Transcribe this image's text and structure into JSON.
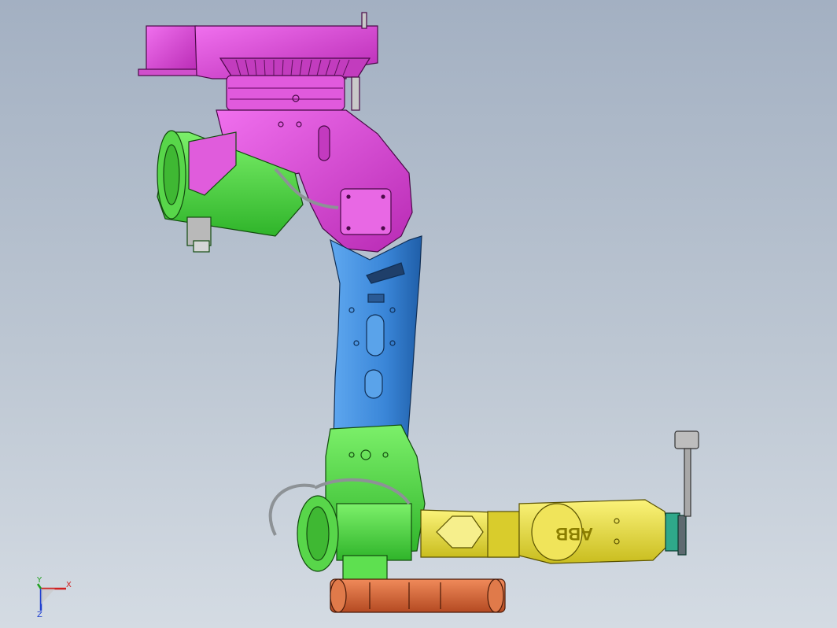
{
  "brand_text": "ABB",
  "triad": {
    "x_label": "X",
    "y_label": "Y",
    "z_label": "Z"
  },
  "colors": {
    "base": "#e040d8",
    "base_dark": "#8a1a86",
    "upper_arm": "#3c8ee0",
    "upper_arm_dark": "#1d4f8a",
    "motor_green": "#4fe040",
    "motor_green_dark": "#1f7a18",
    "forearm_yellow": "#ece03a",
    "wrist_teal": "#2fa88a",
    "counterweight_orange": "#d86a3e",
    "cable_gray": "#9ea3a6"
  }
}
